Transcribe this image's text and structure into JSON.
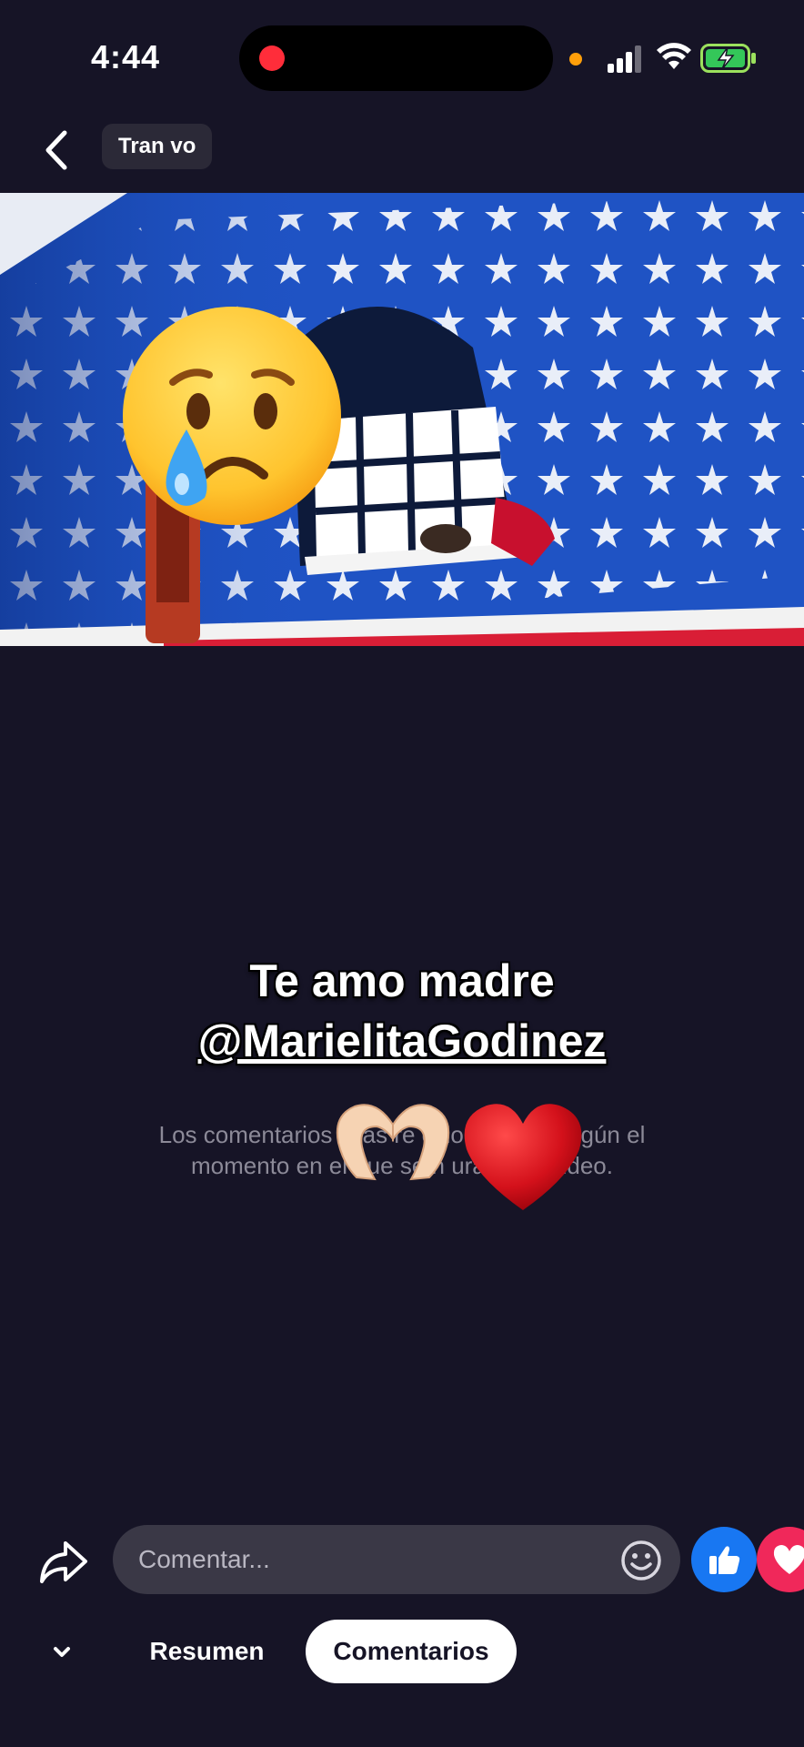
{
  "status_bar": {
    "time": "4:44"
  },
  "header": {
    "title": "Transmisión en vivo",
    "title_visible": "Tran                   vo"
  },
  "video": {
    "caption_line1": "Te amo madre",
    "caption_mention": "@MarielitaGodinez",
    "overlay_emojis": [
      "crying-face",
      "heart-hands",
      "red-heart"
    ]
  },
  "info": {
    "text": "Los comentarios y las reacciones se mostrarán según el momento en el que se hayan hecho para durante el video.",
    "line1": "Los comentarios y las re         ccio    es                       arán según el",
    "line2": "momento en el que se h                                      urante el video."
  },
  "composer": {
    "placeholder": "Comentar..."
  },
  "reactions": [
    "like",
    "love"
  ],
  "tabs": {
    "summary": "Resumen",
    "comments": "Comentarios",
    "active": "comments"
  },
  "colors": {
    "background": "#161426",
    "like": "#1877f2",
    "love": "#f0285a",
    "input": "#3a3846"
  }
}
